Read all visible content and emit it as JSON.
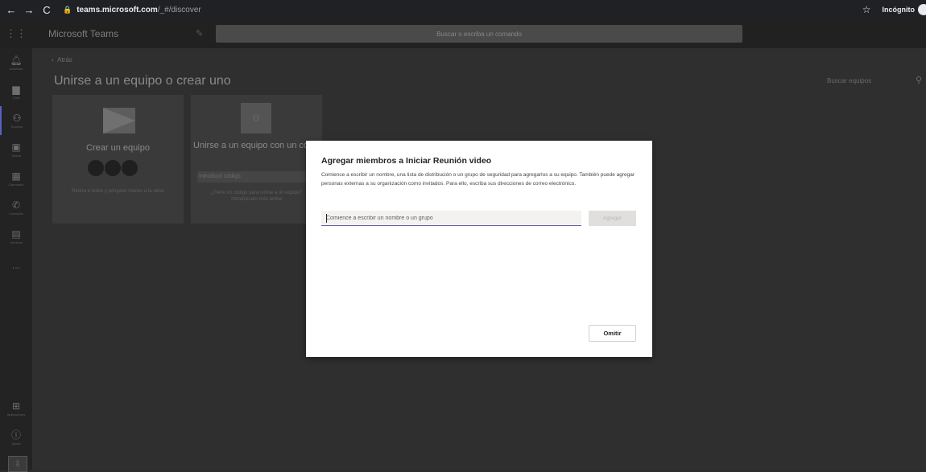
{
  "browser": {
    "url_host": "teams.microsoft.com",
    "url_path": "/_#/discover",
    "profile_label": "Incógnito"
  },
  "header": {
    "app_title": "Microsoft Teams",
    "search_placeholder": "Buscar o escriba un comando"
  },
  "rail": {
    "items": [
      {
        "label": "Actividad",
        "icon": "bell-icon"
      },
      {
        "label": "Chat",
        "icon": "chat-icon"
      },
      {
        "label": "Equipos",
        "icon": "teams-icon"
      },
      {
        "label": "Tareas",
        "icon": "tasks-icon"
      },
      {
        "label": "Calendario",
        "icon": "calendar-icon"
      },
      {
        "label": "Llamadas",
        "icon": "phone-icon"
      },
      {
        "label": "Archivos",
        "icon": "files-icon"
      },
      {
        "label": "...",
        "icon": "more-icon"
      },
      {
        "label": "Aplicaciones",
        "icon": "apps-icon"
      },
      {
        "label": "Ayuda",
        "icon": "help-icon"
      }
    ],
    "active_index": 2
  },
  "main": {
    "back_label": "Atrás",
    "title": "Unirse a un equipo o crear uno",
    "search_placeholder": "Buscar equipos",
    "create_card": {
      "title": "Crear un equipo",
      "description": "Reúna a todos y póngase manos a la obra!"
    },
    "join_card": {
      "title": "Unirse a un equipo con un código",
      "code_placeholder": "Introducir código",
      "description": "¿Tiene un código para unirse a un equipo? Introdúzcalo más arriba"
    }
  },
  "modal": {
    "title": "Agregar miembros a Iniciar Reunión video",
    "description": "Comience a escribir un nombre, una lista de distribución o un grupo de seguridad para agregarlos a su equipo. También puede agregar personas externas a su organización como invitados. Para ello, escriba sus direcciones de correo electrónico.",
    "input_placeholder": "Comience a escribir un nombre o un grupo",
    "add_label": "Agregar",
    "skip_label": "Omitir"
  },
  "colors": {
    "accent": "#6264a7",
    "overlay": "#2f2f2f"
  }
}
